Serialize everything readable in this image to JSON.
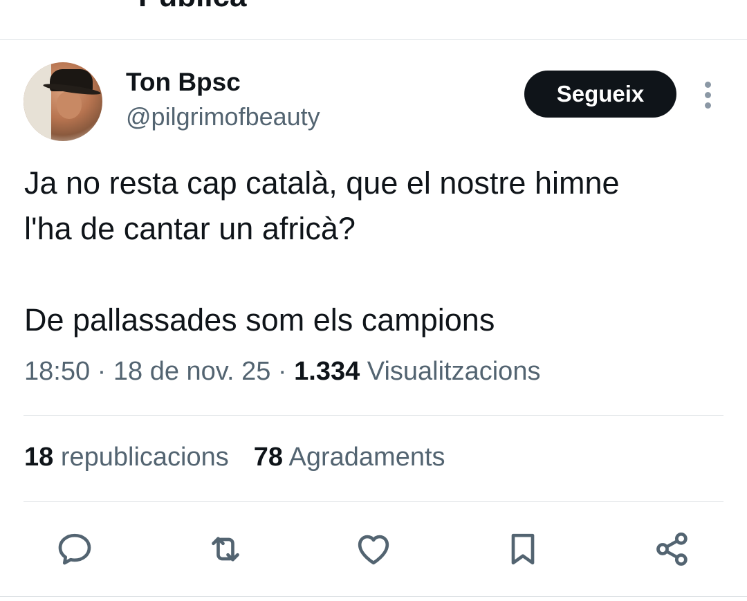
{
  "header": {
    "back_icon": "arrow-left-icon",
    "title": "Publica"
  },
  "tweet": {
    "author_name": "Ton Bpsc",
    "author_handle": "@pilgrimofbeauty",
    "follow_label": "Segueix",
    "more_icon": "more-vertical-icon",
    "text_line1": "Ja no resta cap català, que el nostre himne",
    "text_line2": "l'ha de cantar un africà?",
    "text_line3": "De pallassades som els campions",
    "time": "18:50",
    "separator": "·",
    "date": "18 de nov. 25",
    "views_count": "1.334",
    "views_label": "Visualitzacions"
  },
  "stats": {
    "reposts_count": "18",
    "reposts_label": "republicacions",
    "likes_count": "78",
    "likes_label": "Agradaments"
  },
  "actions": [
    {
      "icon": "reply-icon"
    },
    {
      "icon": "repost-icon"
    },
    {
      "icon": "like-icon"
    },
    {
      "icon": "bookmark-icon"
    },
    {
      "icon": "share-icon"
    }
  ],
  "colors": {
    "text_primary": "#0f1419",
    "text_secondary": "#536471",
    "divider": "#dfe3e6",
    "button_bg": "#0f1419",
    "icon": "#536471"
  }
}
